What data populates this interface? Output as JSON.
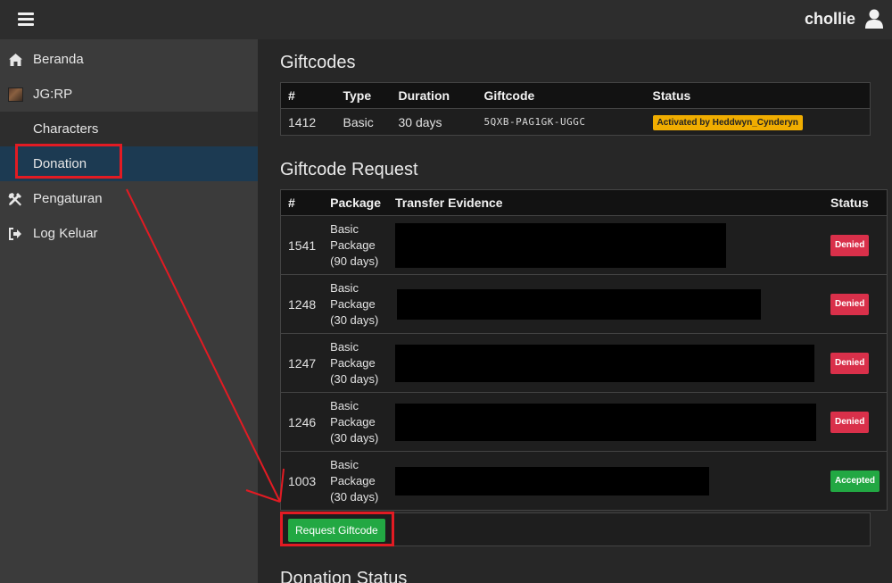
{
  "topbar": {
    "username": "chollie"
  },
  "sidebar": {
    "items": [
      {
        "label": "Beranda",
        "icon": "home-icon"
      },
      {
        "label": "JG:RP",
        "icon": "avatar-icon"
      },
      {
        "label": "Characters"
      },
      {
        "label": "Donation"
      },
      {
        "label": "Pengaturan",
        "icon": "tools-icon"
      },
      {
        "label": "Log Keluar",
        "icon": "sign-out-icon"
      }
    ]
  },
  "giftcodes": {
    "title": "Giftcodes",
    "headers": [
      "#",
      "Type",
      "Duration",
      "Giftcode",
      "Status"
    ],
    "rows": [
      {
        "id": "1412",
        "type": "Basic",
        "duration": "30 days",
        "code": "5QXB-PAG1GK-UGGC",
        "status": "Activated by Heddwyn_Cynderyn"
      }
    ]
  },
  "requests": {
    "title": "Giftcode Request",
    "headers": [
      "#",
      "Package",
      "Transfer Evidence",
      "Status"
    ],
    "rows": [
      {
        "id": "1541",
        "package_l1": "Basic",
        "package_l2": "Package",
        "package_l3": "(90 days)",
        "status": "Denied"
      },
      {
        "id": "1248",
        "package_l1": "Basic",
        "package_l2": "Package",
        "package_l3": "(30 days)",
        "status": "Denied"
      },
      {
        "id": "1247",
        "package_l1": "Basic",
        "package_l2": "Package",
        "package_l3": "(30 days)",
        "status": "Denied"
      },
      {
        "id": "1246",
        "package_l1": "Basic",
        "package_l2": "Package",
        "package_l3": "(30 days)",
        "status": "Denied"
      },
      {
        "id": "1003",
        "package_l1": "Basic",
        "package_l2": "Package",
        "package_l3": "(30 days)",
        "status": "Accepted"
      }
    ],
    "request_button": "Request Giftcode"
  },
  "donation_status": {
    "title": "Donation Status"
  },
  "colors": {
    "accent_green": "#22a843",
    "denied_red": "#d9304a",
    "warning_yellow": "#f0ad00",
    "annotation_red": "#e21b23",
    "active_nav": "#1c3a52"
  }
}
